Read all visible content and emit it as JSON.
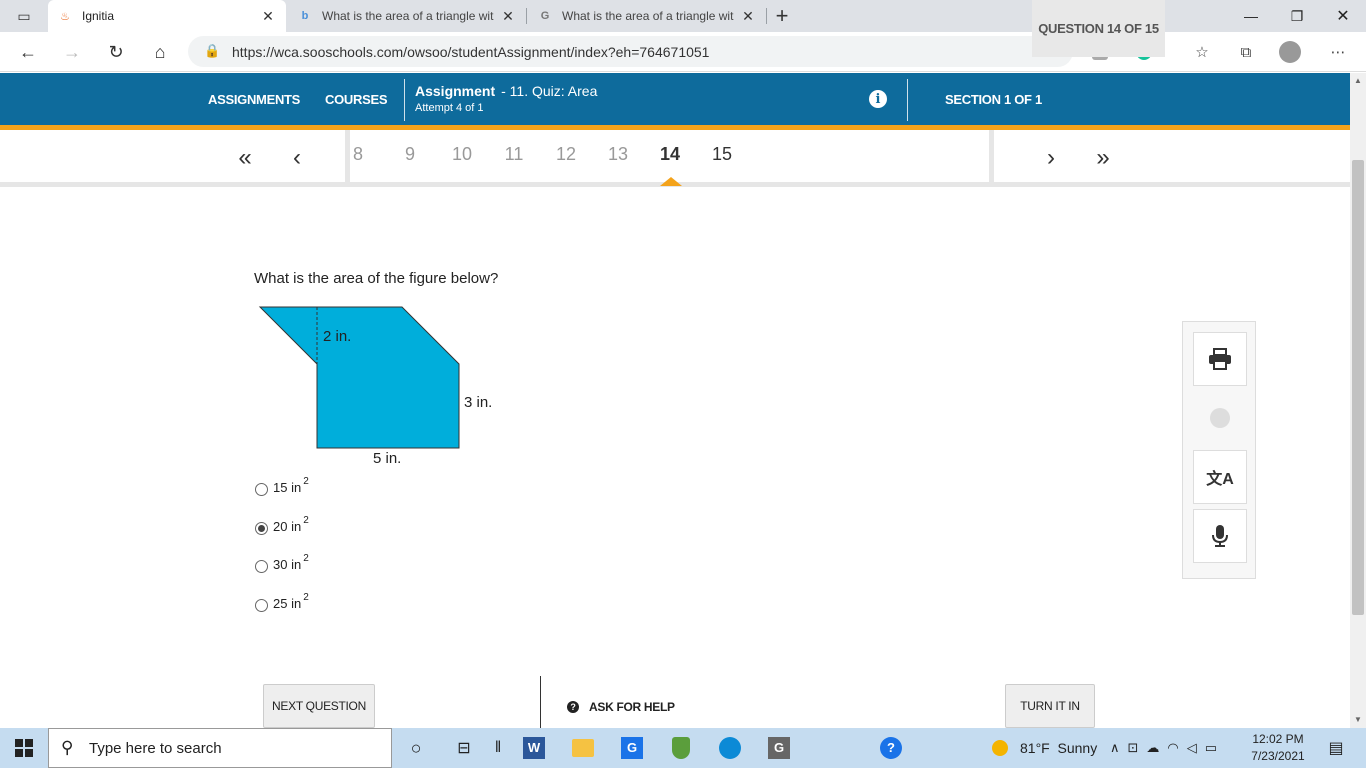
{
  "browser": {
    "tabs": [
      {
        "title": "Ignitia",
        "active": true
      },
      {
        "title": "What is the area of a triangle wit",
        "active": false
      },
      {
        "title": "What is the area of a triangle wit",
        "active": false
      }
    ],
    "new_tab": "+",
    "url": "https://wca.sooschools.com/owsoo/studentAssignment/index?eh=764671051"
  },
  "header": {
    "assignments": "ASSIGNMENTS",
    "courses": "COURSES",
    "assignment_label": "Assignment",
    "assignment_name": "- 11. Quiz: Area",
    "attempt": "Attempt 4 of 1",
    "section": "SECTION 1 OF 1",
    "question_counter": "QUESTION 14 OF 15"
  },
  "pager": {
    "numbers": [
      "8",
      "9",
      "10",
      "11",
      "12",
      "13",
      "14",
      "15"
    ],
    "current": "14"
  },
  "question": {
    "prompt": "What is the area of the figure below?",
    "figure": {
      "label_top": "2 in.",
      "label_right": "3 in.",
      "label_bottom": "5 in.",
      "fill": "#00aedb"
    },
    "choices": [
      {
        "value": "15 in",
        "exp": "2",
        "selected": false
      },
      {
        "value": "20 in",
        "exp": "2",
        "selected": true
      },
      {
        "value": "30 in",
        "exp": "2",
        "selected": false
      },
      {
        "value": "25 in",
        "exp": "2",
        "selected": false
      }
    ]
  },
  "footer": {
    "next": "NEXT QUESTION",
    "help": "ASK FOR HELP",
    "turn_in": "TURN IT IN"
  },
  "taskbar": {
    "search_placeholder": "Type here to search",
    "weather": "81°F  Sunny",
    "time": "12:02 PM",
    "date": "7/23/2021"
  },
  "colors": {
    "header_bg": "#0e6b9c",
    "accent": "#f4a31b"
  }
}
